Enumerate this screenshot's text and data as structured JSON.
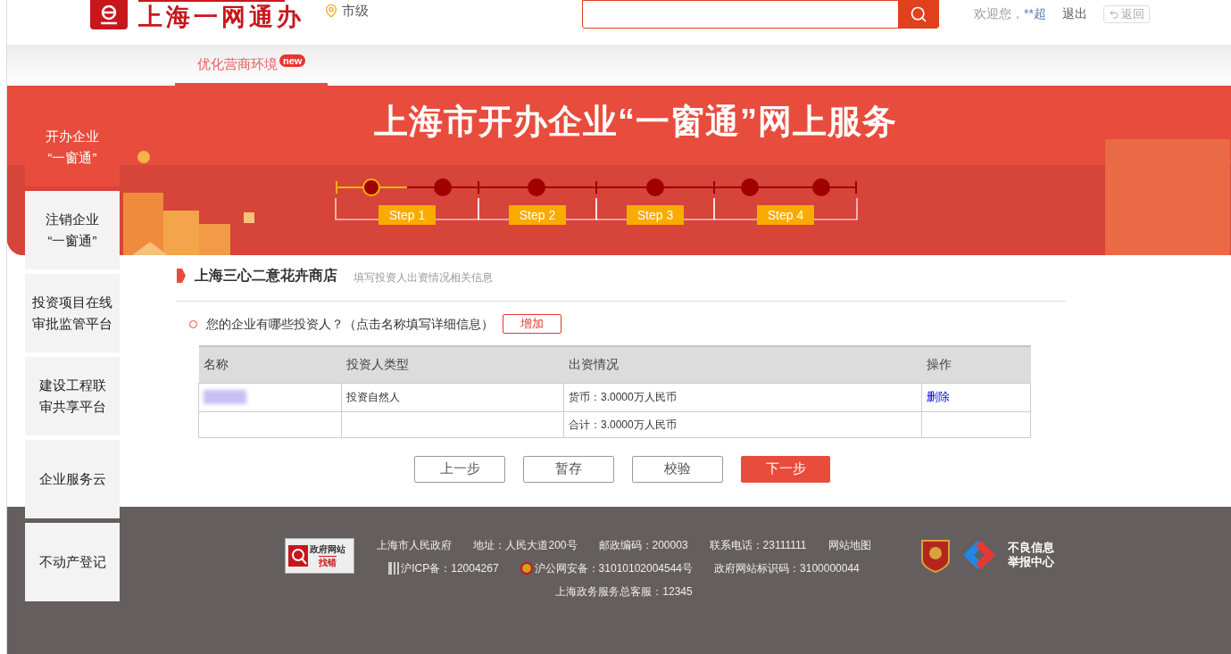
{
  "header": {
    "logo_text": "上海一网通办",
    "location": "市级",
    "welcome": "欢迎您，",
    "user": "**超",
    "logout": "退出",
    "back": "返回"
  },
  "nav": {
    "tabs": [
      {
        "label": "优化营商环境",
        "badge": "new",
        "selected": true
      }
    ]
  },
  "banner": {
    "title": "上海市开办企业“一窗通”网上服务",
    "dots": [
      {
        "selected": true
      },
      {
        "selected": false
      },
      {
        "selected": false
      },
      {
        "selected": false
      },
      {
        "selected": false
      },
      {
        "selected": false
      }
    ],
    "steps": [
      {
        "label": "Step 1"
      },
      {
        "label": "Step 2"
      },
      {
        "label": "Step 3"
      },
      {
        "label": "Step 4"
      }
    ]
  },
  "sidebar": {
    "items": [
      {
        "lines": [
          "开办企业",
          "“一窗通”"
        ],
        "selected": true
      },
      {
        "lines": [
          "注销企业",
          "“一窗通”"
        ],
        "selected": false
      },
      {
        "lines": [
          "投资项目在线",
          "审批监管平台"
        ],
        "selected": false
      },
      {
        "lines": [
          "建设工程联",
          "审共享平台"
        ],
        "selected": false
      },
      {
        "lines": [
          "企业服务云"
        ],
        "selected": false
      },
      {
        "lines": [
          "不动产登记"
        ],
        "selected": false
      }
    ]
  },
  "section": {
    "title": "上海三心二意花卉商店",
    "subtitle": "填写投资人出资情况相关信息",
    "question": "您的企业有哪些投资人？（点击名称填写详细信息）",
    "add_button": "增加"
  },
  "table": {
    "columns": [
      "名称",
      "投资人类型",
      "出资情况",
      "操作"
    ],
    "rows": [
      [
        {
          "kind": "redacted"
        },
        {
          "kind": "text",
          "text": "投资自然人"
        },
        {
          "kind": "text",
          "text": "货币：3.0000万人民币"
        },
        {
          "kind": "link",
          "text": "删除"
        }
      ],
      [
        {
          "kind": "empty"
        },
        {
          "kind": "empty"
        },
        {
          "kind": "text",
          "text": "合计：3.0000万人民币"
        },
        {
          "kind": "empty"
        }
      ]
    ]
  },
  "buttons": [
    {
      "label": "上一步",
      "primary": false
    },
    {
      "label": "暂存",
      "primary": false
    },
    {
      "label": "校验",
      "primary": false
    },
    {
      "label": "下一步",
      "primary": true
    }
  ],
  "footer": {
    "error_badge": {
      "top": "政府网站",
      "bottom": "找错"
    },
    "lines": [
      [
        "上海市人民政府",
        "地址：人民大道200号",
        "邮政编码：200003",
        "联系电话：23111111",
        "网站地图"
      ],
      [
        "沪ICP备：12004267",
        "沪公网安备：31010102004544号",
        "政府网站标识码：3100000044"
      ],
      [
        "上海政务服务总客服：12345"
      ]
    ],
    "report": [
      "不良信息",
      "举报中心"
    ]
  }
}
